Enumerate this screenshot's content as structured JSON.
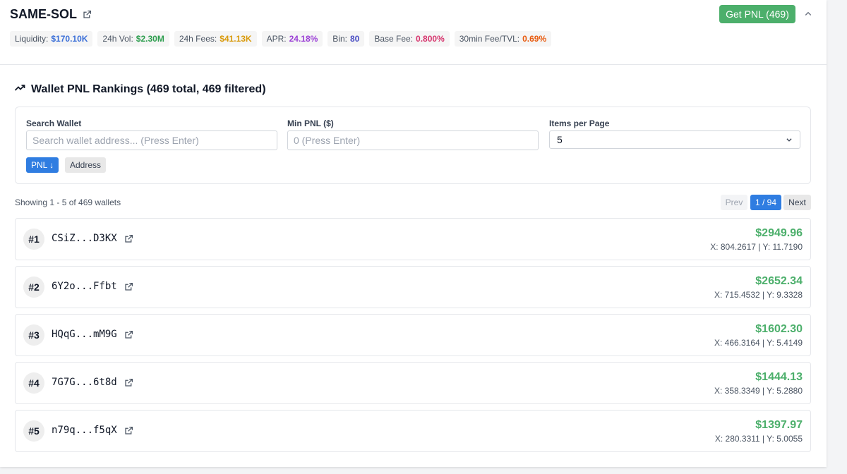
{
  "header": {
    "pair_name": "SAME-SOL",
    "pnl_button_label": "Get PNL (469)"
  },
  "stats": [
    {
      "label": "Liquidity:",
      "value": "$170.10K",
      "color": "#3b6fd8"
    },
    {
      "label": "24h Vol:",
      "value": "$2.30M",
      "color": "#2e9e4f"
    },
    {
      "label": "24h Fees:",
      "value": "$41.13K",
      "color": "#d99a0b"
    },
    {
      "label": "APR:",
      "value": "24.18%",
      "color": "#9b3fd6"
    },
    {
      "label": "Bin:",
      "value": "80",
      "color": "#4b4fc4"
    },
    {
      "label": "Base Fee:",
      "value": "0.800%",
      "color": "#d6336c"
    },
    {
      "label": "30min Fee/TVL:",
      "value": "0.69%",
      "color": "#e8590c"
    }
  ],
  "rankings": {
    "title": "Wallet PNL Rankings (469 total, 469 filtered)"
  },
  "filters": {
    "search_label": "Search Wallet",
    "search_placeholder": "Search wallet address... (Press Enter)",
    "min_pnl_label": "Min PNL ($)",
    "min_pnl_placeholder": "0 (Press Enter)",
    "items_label": "Items per Page",
    "items_value": "5",
    "sort_pnl_label": "PNL ↓",
    "sort_address_label": "Address"
  },
  "pagination": {
    "showing": "Showing 1 - 5 of 469 wallets",
    "prev": "Prev",
    "page": "1 / 94",
    "next": "Next"
  },
  "wallets": [
    {
      "rank": "#1",
      "address": "CSiZ...D3KX",
      "pnl": "$2949.96",
      "xy": "X: 804.2617 | Y: 11.7190"
    },
    {
      "rank": "#2",
      "address": "6Y2o...Ffbt",
      "pnl": "$2652.34",
      "xy": "X: 715.4532 | Y: 9.3328"
    },
    {
      "rank": "#3",
      "address": "HQqG...mM9G",
      "pnl": "$1602.30",
      "xy": "X: 466.3164 | Y: 5.4149"
    },
    {
      "rank": "#4",
      "address": "7G7G...6t8d",
      "pnl": "$1444.13",
      "xy": "X: 358.3349 | Y: 5.2880"
    },
    {
      "rank": "#5",
      "address": "n79q...f5qX",
      "pnl": "$1397.97",
      "xy": "X: 280.3311 | Y: 5.0055"
    }
  ],
  "colors": {
    "accent_green": "#4caf6b",
    "accent_blue": "#2f7de1"
  }
}
